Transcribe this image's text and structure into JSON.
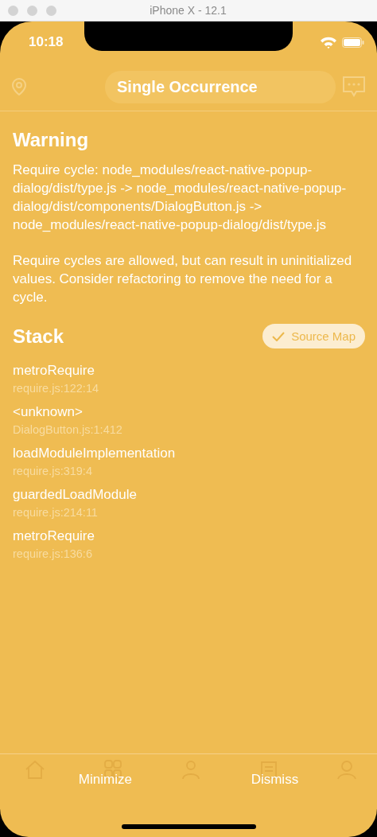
{
  "window": {
    "title": "iPhone X - 12.1"
  },
  "status_bar": {
    "time": "10:18"
  },
  "log_box": {
    "header": "Single Occurrence",
    "title": "Warning",
    "messages": [
      "Require cycle: node_modules/react-native-popup-dialog/dist/type.js -> node_modules/react-native-popup-dialog/dist/components/DialogButton.js -> node_modules/react-native-popup-dialog/dist/type.js",
      "Require cycles are allowed, but can result in uninitialized values. Consider refactoring to remove the need for a cycle."
    ],
    "stack_title": "Stack",
    "source_map": {
      "label": "Source Map",
      "checked": true
    },
    "frames": [
      {
        "name": "metroRequire",
        "location": "require.js:122:14"
      },
      {
        "name": "<unknown>",
        "location": "DialogButton.js:1:412"
      },
      {
        "name": "loadModuleImplementation",
        "location": "require.js:319:4"
      },
      {
        "name": "guardedLoadModule",
        "location": "require.js:214:11"
      },
      {
        "name": "metroRequire",
        "location": "require.js:136:6"
      }
    ],
    "buttons": [
      "Minimize",
      "Dismiss"
    ]
  }
}
